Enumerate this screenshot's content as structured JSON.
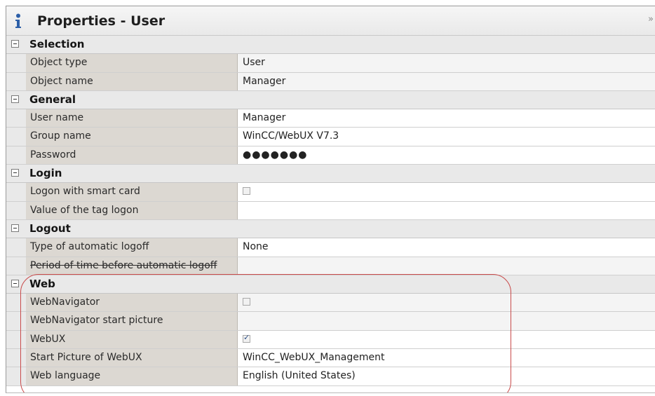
{
  "panel": {
    "title": "Properties - User",
    "collapse_glyph": "»",
    "title_icon": "info-icon"
  },
  "sections": [
    {
      "label": "Selection",
      "rows": [
        {
          "name": "Object type",
          "value": "User"
        },
        {
          "name": "Object name",
          "value": "Manager"
        }
      ]
    },
    {
      "label": "General",
      "rows": [
        {
          "name": "User name",
          "value": "Manager"
        },
        {
          "name": "Group name",
          "value": "WinCC/WebUX V7.3"
        },
        {
          "name": "Password",
          "value": "●●●●●●●"
        }
      ]
    },
    {
      "label": "Login",
      "rows": [
        {
          "name": "Logon with smart card",
          "value": "",
          "checkbox": false
        },
        {
          "name": "Value of the tag logon",
          "value": ""
        }
      ]
    },
    {
      "label": "Logout",
      "rows": [
        {
          "name": "Type of automatic logoff",
          "value": "None"
        },
        {
          "name": "Period of time before automatic logoff",
          "value": ""
        }
      ]
    },
    {
      "label": "Web",
      "rows": [
        {
          "name": "WebNavigator",
          "value": "",
          "checkbox": false
        },
        {
          "name": "WebNavigator start picture",
          "value": ""
        },
        {
          "name": "WebUX",
          "value": "",
          "checkbox": true
        },
        {
          "name": "Start Picture of WebUX",
          "value": "WinCC_WebUX_Management"
        },
        {
          "name": "Web language",
          "value": "English (United States)"
        }
      ]
    }
  ],
  "colors": {
    "highlight": "#c94a4a",
    "name_column": "#dcd8d2",
    "category_row": "#e9e9e9"
  }
}
